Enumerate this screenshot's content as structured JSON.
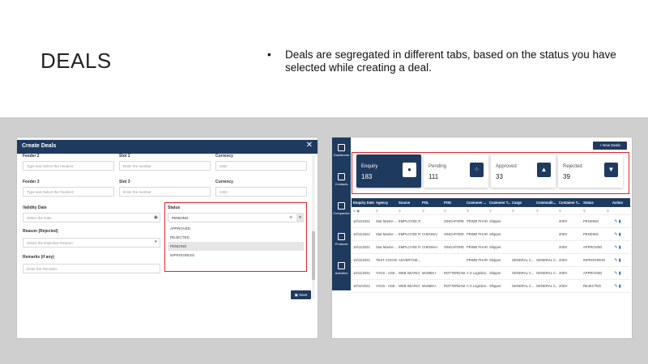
{
  "slide": {
    "title": "DEALS",
    "bullet": "Deals are segregated in different tabs, based on the status you have selected while creating a deal."
  },
  "create_dialog": {
    "title": "Create Deals",
    "fields": {
      "feeder2": {
        "label": "Feeder 2",
        "placeholder": "Type and Select the Feeder2"
      },
      "slot2": {
        "label": "Slot 2",
        "placeholder": "Enter the number"
      },
      "currency1": {
        "label": "Currency",
        "value": "USD"
      },
      "feeder3": {
        "label": "Feeder 3",
        "placeholder": "Type and Select the Feeder3"
      },
      "slot3": {
        "label": "Slot 3",
        "placeholder": "Enter the number"
      },
      "currency2": {
        "label": "Currency",
        "value": "USD"
      },
      "validity": {
        "label": "Validity Date",
        "placeholder": "Select the Date"
      },
      "status": {
        "label": "Status",
        "value": "PENDING",
        "options": [
          "APPROVED",
          "REJECTED",
          "PENDING",
          "INPROGRESS"
        ]
      },
      "reason": {
        "label": "Reason (Rejected)",
        "placeholder": "Select the Rejection Reason"
      },
      "remarks": {
        "label": "Remarks (if any)",
        "placeholder": "Enter the Remarks"
      }
    },
    "save_label": "Save"
  },
  "deals_page": {
    "new_deals_label": "+ New Deals",
    "sidebar": [
      "Dashboard",
      "Contacts",
      "Companies",
      "Products",
      "Activities"
    ],
    "cards": [
      {
        "label": "Enquiry",
        "value": "183"
      },
      {
        "label": "Pending",
        "value": "111"
      },
      {
        "label": "Approved",
        "value": "33"
      },
      {
        "label": "Rejected",
        "value": "39"
      }
    ],
    "table": {
      "headers": [
        "Enquiry Date",
        "Agency",
        "Source",
        "POL",
        "POD",
        "Customer ...",
        "Customer T...",
        "Cargo",
        "Commodit...",
        "Container T...",
        "Status",
        "Action"
      ],
      "rows": [
        [
          "10/11/2022",
          "Star Marine ...",
          "EMPLOYEE R...",
          "",
          "SINGAPORE",
          "PRIME PHAR...",
          "Shipper",
          "",
          "",
          "20DV",
          "PENDING"
        ],
        [
          "10/11/2022",
          "Star Marine ...",
          "EMPLOYEE R...",
          "CHENNAI",
          "SINGAPORE",
          "PRIME PHAR...",
          "Shipper",
          "",
          "",
          "20DV",
          "PENDING"
        ],
        [
          "10/11/2022",
          "Star Marine ...",
          "EMPLOYEE R...",
          "CHENNAI",
          "SINGAPORE",
          "PRIME PHAR...",
          "Shipper",
          "",
          "",
          "20DV",
          "APPROVED"
        ],
        [
          "10/11/2022",
          "TEST COCHIN",
          "ADVERTISE...",
          "",
          "",
          "PRIME PHAR...",
          "Shipper",
          "GENERAL C...",
          "GENERAL C...",
          "20DV",
          "INPROGRESS"
        ],
        [
          "10/11/2022",
          "YAGS - AGE...",
          "WEB SEARCH",
          "MUMBAI",
          "ROTTERDAM",
          "A S Logistics...",
          "Shipper",
          "GENERAL C...",
          "GENERAL C...",
          "20DV",
          "APPROVED"
        ],
        [
          "10/11/2022",
          "YAGS - AGE...",
          "WEB SEARCH",
          "MUMBAI",
          "ROTTERDAM",
          "A S Logistics...",
          "Shipper",
          "GENERAL C...",
          "GENERAL C...",
          "20DV",
          "REJECTED"
        ]
      ]
    }
  }
}
